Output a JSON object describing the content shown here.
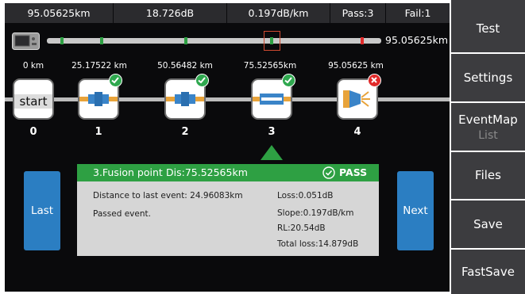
{
  "status": {
    "distance": "95.05625km",
    "loss": "18.726dB",
    "slope": "0.197dB/km",
    "pass": "Pass:3",
    "fail": "Fail:1"
  },
  "overview": {
    "total_distance": "95.05625km",
    "colors": {
      "pass_tick": "#2ea043",
      "fail_tick": "#e02a2a",
      "cursor": "#d04a30"
    }
  },
  "events": [
    {
      "number": "0",
      "distance": "0 km",
      "type": "start",
      "label": "start",
      "status": "none",
      "icon": "start-icon"
    },
    {
      "number": "1",
      "distance": "25.17522 km",
      "type": "connector",
      "status": "pass",
      "icon": "connector-icon"
    },
    {
      "number": "2",
      "distance": "50.56482 km",
      "type": "connector",
      "status": "pass",
      "icon": "connector-icon"
    },
    {
      "number": "3",
      "distance": "75.52565km",
      "type": "fusion",
      "status": "pass",
      "icon": "fusion-splice-icon"
    },
    {
      "number": "4",
      "distance": "95.05625 km",
      "type": "end",
      "status": "fail",
      "icon": "fiber-end-icon"
    }
  ],
  "detail": {
    "title": "3.Fusion point",
    "dis": "Dis:75.52565km",
    "result": "PASS",
    "distance_to_last": "Distance to last event: 24.96083km",
    "message": "Passed event.",
    "loss": "Loss:0.051dB",
    "slope": "Slope:0.197dB/km",
    "rl": "RL:20.54dB",
    "total_loss": "Total loss:14.879dB"
  },
  "nav": {
    "last": "Last",
    "next": "Next"
  },
  "menu": {
    "test": "Test",
    "settings": "Settings",
    "eventmap": "EventMap",
    "eventmap_sub": "List",
    "files": "Files",
    "save": "Save",
    "fastsave": "FastSave"
  },
  "colors": {
    "accent": "#2ea043",
    "button_blue": "#2b7ec2",
    "fail": "#e02a2a",
    "menu_bg": "#3c3c3f"
  }
}
